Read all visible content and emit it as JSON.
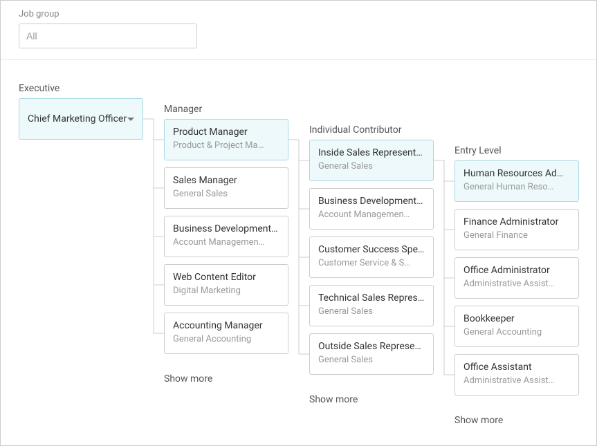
{
  "filter": {
    "label": "Job group",
    "placeholder": "All"
  },
  "columns": {
    "executive": {
      "title": "Executive"
    },
    "manager": {
      "title": "Manager",
      "show_more": "Show more"
    },
    "individual": {
      "title": "Individual Contributor",
      "show_more": "Show more"
    },
    "entry": {
      "title": "Entry Level",
      "show_more": "Show more"
    }
  },
  "executive_node": {
    "label": "Chief Marketing Officer"
  },
  "managers": [
    {
      "title": "Product Manager",
      "sub": "Product & Project Ma…"
    },
    {
      "title": "Sales Manager",
      "sub": "General Sales"
    },
    {
      "title": "Business Development …",
      "sub": "Account Managemen…"
    },
    {
      "title": "Web Content Editor",
      "sub": "Digital Marketing"
    },
    {
      "title": "Accounting Manager",
      "sub": "General Accounting"
    }
  ],
  "individuals": [
    {
      "title": "Inside Sales Representat…",
      "sub": "General Sales"
    },
    {
      "title": "Business Development R…",
      "sub": "Account Managemen…"
    },
    {
      "title": "Customer Success Speci…",
      "sub": "Customer Service & S…"
    },
    {
      "title": "Technical Sales Represe…",
      "sub": "General Sales"
    },
    {
      "title": "Outside Sales Represent…",
      "sub": "General Sales"
    }
  ],
  "entry": [
    {
      "title": "Human Resources Admi…",
      "sub": "General Human Reso…"
    },
    {
      "title": "Finance Administrator",
      "sub": "General Finance"
    },
    {
      "title": "Office Administrator",
      "sub": "Administrative Assist…"
    },
    {
      "title": "Bookkeeper",
      "sub": "General Accounting"
    },
    {
      "title": "Office Assistant",
      "sub": "Administrative Assist…"
    }
  ]
}
